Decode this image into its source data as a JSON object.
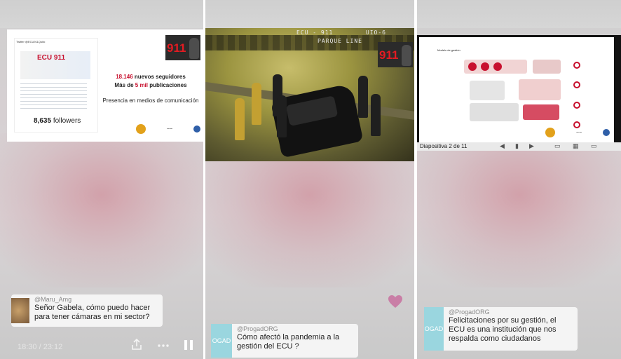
{
  "panel1": {
    "slide": {
      "card_header": "Twitter @ECU911Quito",
      "card_logo": "ECU 911",
      "followers_num": "8,635",
      "followers_label": "followers",
      "line1_num": "18.146",
      "line1_rest": "nuevos seguidores",
      "line2_pre": "Más de",
      "line2_num": "5 mil",
      "line2_rest": "publicaciones",
      "line3": "Presencia en medios de comunicación",
      "badge": "911"
    },
    "comment": {
      "user": "@Maru_Amg",
      "text": "Señor Gabela, cómo puedo hacer para tener cámaras en mi sector?"
    },
    "controls": {
      "time": "18:30 / 23:12",
      "share_icon": "share-icon",
      "more_icon": "more-icon",
      "pause_icon": "pause-icon"
    }
  },
  "panel2": {
    "video": {
      "overlay_line1": "ECU - 911",
      "overlay_line1b": "UIO-6",
      "overlay_line2": "PARQUE LINE",
      "badge": "911"
    },
    "comment": {
      "avatar_text": "OGAD",
      "user": "@ProgadORG",
      "text": "Cómo afectó la pandemia a la gestión del ECU ?"
    },
    "heart_color": "#c97ea6"
  },
  "panel3": {
    "slide": {
      "title": "Modelo de gestión",
      "status": "Diapositiva 2 de 11"
    },
    "comment": {
      "avatar_text": "OGAD",
      "user": "@ProgadORG",
      "text": "Felicitaciones por su gestión, el ECU es una institución que nos respalda como ciudadanos"
    }
  },
  "colors": {
    "accent_red": "#c8102e",
    "comment_bg": "#f4f4f4",
    "avatar_teal": "#9ad6df"
  }
}
